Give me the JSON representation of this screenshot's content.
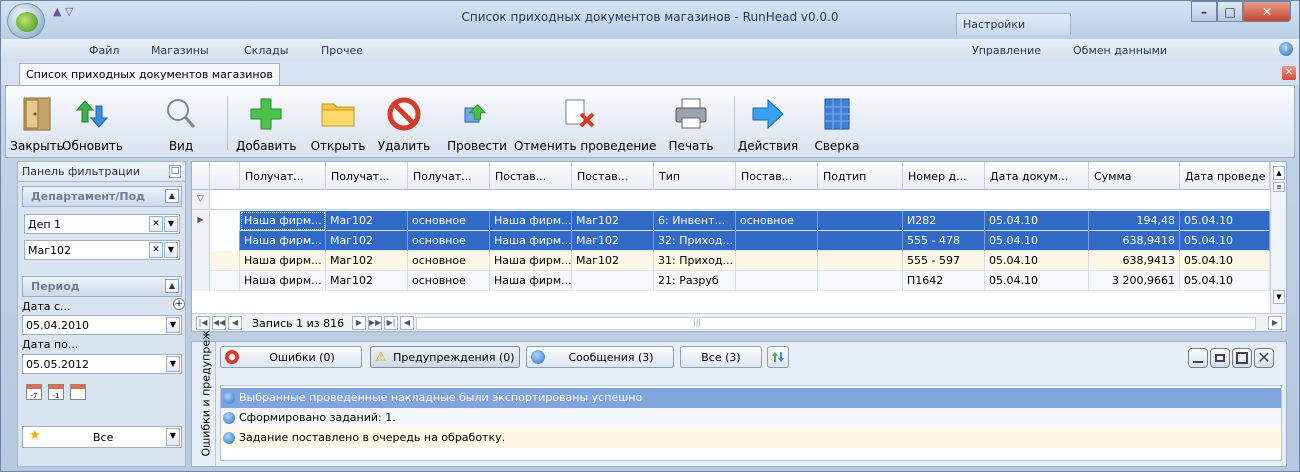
{
  "window": {
    "title": "Список приходных документов магазинов - RunHead v0.0.0",
    "settings_tab": "Настройки"
  },
  "menu": {
    "left": [
      "Файл",
      "Магазины",
      "Склады",
      "Прочее"
    ],
    "right": [
      "Управление",
      "Обмен данными"
    ]
  },
  "document_tab": "Список приходных документов магазинов",
  "toolbar": {
    "close": "Закрыть",
    "refresh": "Обновить",
    "view": "Вид",
    "add": "Добавить",
    "open": "Открыть",
    "delete": "Удалить",
    "post": "Провести",
    "unpost": "Отменить проведение",
    "print": "Печать",
    "actions": "Действия",
    "reconcile": "Сверка"
  },
  "filter_panel": {
    "title": "Панель фильтрации",
    "department_group": "Департамент/Под",
    "department_value": "Деп 1",
    "store_value": "Маг102",
    "period_group": "Период",
    "date_from_label": "Дата с...",
    "date_from_value": "05.04.2010",
    "date_to_label": "Дата по...",
    "date_to_value": "05.05.2012",
    "all_label": "Все"
  },
  "grid": {
    "columns": [
      "Получат...",
      "Получат...",
      "Получат...",
      "Постав...",
      "Постав...",
      "Тип",
      "Постав...",
      "Подтип",
      "Номер д...",
      "Дата докум...",
      "Сумма",
      "Дата проведе"
    ],
    "rows": [
      [
        "Наша фирм...",
        "Маг102",
        "основное",
        "Наша фирм...",
        "Маг102",
        "6: Инвент...",
        "основное",
        "",
        "И282",
        "05.04.10",
        "194,48",
        "05.04.10"
      ],
      [
        "Наша фирм...",
        "Маг102",
        "основное",
        "Наша фирм...",
        "Маг102",
        "32: Приход...",
        "",
        "",
        "555 - 478",
        "05.04.10",
        "638,9418",
        "05.04.10"
      ],
      [
        "Наша фирм...",
        "Маг102",
        "основное",
        "Наша фирм...",
        "Маг102",
        "31: Приход...",
        "",
        "",
        "555 - 597",
        "05.04.10",
        "638,9413",
        "05.04.10"
      ],
      [
        "Наша фирм...",
        "Маг102",
        "основное",
        "Наша фирм...",
        "",
        "21: Разруб",
        "",
        "",
        "П1642",
        "05.04.10",
        "3 200,9661",
        "05.04.10"
      ]
    ],
    "record_text": "Запись 1 из 816"
  },
  "messages": {
    "side_label": "Ошибки и предупреж",
    "errors_btn": "Ошибки (0)",
    "warnings_btn": "Предупреждения (0)",
    "messages_btn": "Сообщения (3)",
    "all_btn": "Все (3)",
    "items": [
      "Выбранные проведённые накладные были экспортированы успешно",
      "Сформировано заданий: 1.",
      "Задание поставлено в очередь на обработку."
    ]
  }
}
